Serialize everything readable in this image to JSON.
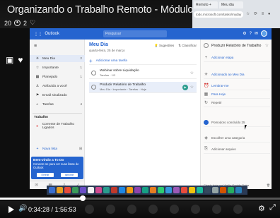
{
  "video": {
    "title": "Organizando o Trabalho Remoto - Módulo 1 - Aula 2",
    "stats_views": "20",
    "stats_likes": "2",
    "time_current": "0:34:28",
    "time_total": "1:56:53",
    "progress_fraction": 0.295
  },
  "browser": {
    "tab1": "Remoto +",
    "tab2": "Meu dia",
    "address": "todo.microsoft.com/tasks/myday"
  },
  "app": {
    "name": "Outlook",
    "search_placeholder": "Pesquisar",
    "sidebar": {
      "items": [
        {
          "label": "Meu Dia",
          "count": "2",
          "icon": "☀"
        },
        {
          "label": "Importante",
          "count": "1",
          "icon": "☆"
        },
        {
          "label": "Planejado",
          "count": "1",
          "icon": "▦"
        },
        {
          "label": "Atribuído a você",
          "count": "",
          "icon": "♙"
        },
        {
          "label": "Email sinalizado",
          "count": "",
          "icon": "⚑"
        },
        {
          "label": "Tarefas",
          "count": "4",
          "icon": "⌂"
        }
      ],
      "group_label": "Trabalho",
      "group_item": "Corrente de Trabalho Ligados",
      "new_list": "Nova lista",
      "signin_title": "Bem-vindo a To Do",
      "signin_text": "Conecte-se para ver suas listas de Outlook",
      "signin_btn1": "Entrar",
      "signin_btn2": "Ignorar"
    },
    "main": {
      "title": "Meu Dia",
      "date": "quarta-feira, 25 de março",
      "tool1": "Sugestões",
      "tool2": "Classificar",
      "add_task": "Adicionar uma tarefa",
      "tasks": [
        {
          "title": "Webinar sobre Liquidação",
          "subtitle": "Tarefas · 1/2",
          "selected": false
        },
        {
          "title": "Produzir Relatório de Trabalho",
          "subtitle": "Meu Dia · Importante · Tarefas · Hoje",
          "selected": true
        }
      ]
    },
    "detail": {
      "title": "Produzir Relatório de Trabalho",
      "rows": [
        {
          "label": "Adicionar etapa",
          "icon": "+",
          "gray": false
        },
        {
          "label": "Adicionado ao Meu Dia",
          "icon": "☀",
          "gray": false
        },
        {
          "label": "Lembrar-me",
          "icon": "⏰",
          "gray": false
        },
        {
          "label": "Para Hoje",
          "icon": "▦",
          "gray": false
        },
        {
          "label": "Repetir",
          "icon": "↻",
          "gray": true
        },
        {
          "label": "Pomodoro concluído 25",
          "icon": "",
          "gray": true,
          "dot": true
        },
        {
          "label": "Escolher uma categoria",
          "icon": "◈",
          "gray": true
        },
        {
          "label": "Adicionar arquivo",
          "icon": "⎘",
          "gray": true
        }
      ],
      "footer_left": "Criado hoje por Vigilio Gontdo Dutra",
      "footer_right": "🗑"
    }
  },
  "colors": {
    "accent": "#2564cf",
    "taskbar": "#2a3a55"
  }
}
